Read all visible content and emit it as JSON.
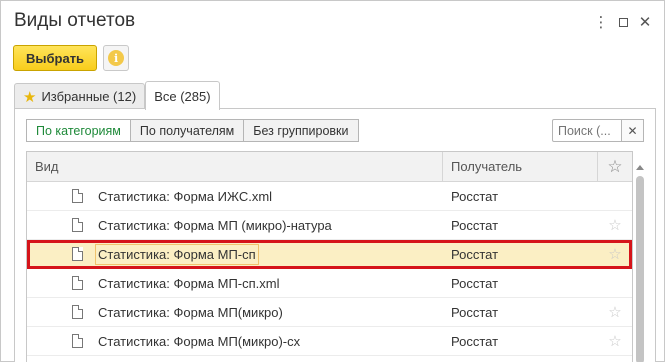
{
  "window": {
    "title": "Виды отчетов",
    "menu_icon": "kebab-menu-icon",
    "maximize_icon": "maximize-icon",
    "close_icon": "close-icon"
  },
  "toolbar": {
    "select_label": "Выбрать",
    "info_symbol": "i"
  },
  "tabs": [
    {
      "label": "Избранные (12)",
      "icon": "star-icon",
      "active": false
    },
    {
      "label": "Все (285)",
      "active": true
    }
  ],
  "grouping": [
    {
      "label": "По категориям",
      "selected": true
    },
    {
      "label": "По получателям",
      "selected": false
    },
    {
      "label": "Без группировки",
      "selected": false
    }
  ],
  "search": {
    "placeholder": "Поиск (..."
  },
  "table": {
    "columns": {
      "name": "Вид",
      "recipient": "Получатель"
    },
    "rows": [
      {
        "name": "Статистика: Форма ИЖС.xml",
        "recipient": "Росстат",
        "selected": false
      },
      {
        "name": "Статистика: Форма МП (микро)-натура",
        "recipient": "Росстат",
        "selected": false
      },
      {
        "name": "Статистика: Форма МП-сп",
        "recipient": "Росстат",
        "selected": true
      },
      {
        "name": "Статистика: Форма МП-сп.xml",
        "recipient": "Росстат",
        "selected": false
      },
      {
        "name": "Статистика: Форма МП(микро)",
        "recipient": "Росстат",
        "selected": false
      },
      {
        "name": "Статистика: Форма МП(микро)-сх",
        "recipient": "Росстат",
        "selected": false
      }
    ]
  },
  "colors": {
    "primary_button": "#f8cd1b",
    "selected_row": "#fbefc4",
    "highlight_border": "#d5141a",
    "selected_group_text": "#1f8a3a"
  }
}
